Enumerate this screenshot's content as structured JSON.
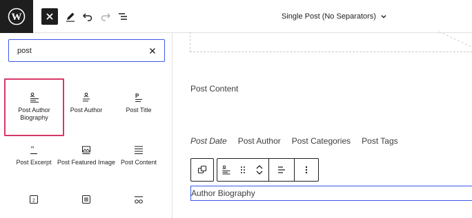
{
  "header": {
    "document_title": "Single Post (No Separators)"
  },
  "inserter": {
    "search_value": "post",
    "blocks": [
      {
        "label": "Post Author Biography",
        "icon": "post-author-biography-icon"
      },
      {
        "label": "Post Author",
        "icon": "post-author-icon"
      },
      {
        "label": "Post Title",
        "icon": "post-title-icon"
      },
      {
        "label": "Post Excerpt",
        "icon": "post-excerpt-icon"
      },
      {
        "label": "Post Featured Image",
        "icon": "post-featured-image-icon"
      },
      {
        "label": "Post Content",
        "icon": "post-content-icon"
      },
      {
        "label": "",
        "icon": "post-date-icon"
      },
      {
        "label": "",
        "icon": "post-terms-icon"
      },
      {
        "label": "",
        "icon": "post-navigation-icon"
      }
    ]
  },
  "canvas": {
    "post_content": "Post Content",
    "meta": {
      "date": "Post Date",
      "author": "Post Author",
      "categories": "Post Categories",
      "tags": "Post Tags"
    },
    "selected_block": "Author Biography"
  },
  "colors": {
    "accent": "#3858e9",
    "highlight": "#d63768",
    "dark": "#1e1e1e"
  }
}
